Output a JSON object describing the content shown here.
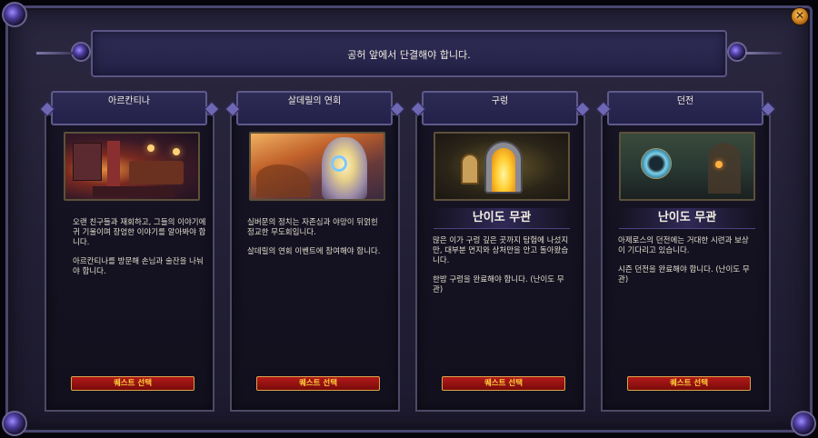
{
  "window": {
    "close_symbol": "✕"
  },
  "banner": {
    "text": "공허 앞에서 단결해야 합니다."
  },
  "cards": [
    {
      "title": "아르칸티나",
      "difficulty": "",
      "description": [
        "오랜 친구들과 재회하고, 그들의 이야기에 귀 기울이며 장엄한 이야기를 알아봐야 합니다.",
        "아르칸티나를 방문해 손님과 술잔을 나눠야 합니다."
      ],
      "button_label": "퀘스트 선택",
      "image_icon": "tavern-scene-image"
    },
    {
      "title": "살데릴의 연회",
      "difficulty": "",
      "description": [
        "실버문의 정치는 자존심과 야망이 뒤얽힌 정교한 무도회입니다.",
        "살데릴의 연회 이벤트에 참여해야 합니다."
      ],
      "button_label": "퀘스트 선택",
      "image_icon": "glowing-tree-image"
    },
    {
      "title": "구렁",
      "difficulty": "난이도 무관",
      "description": [
        "많은 이가 구렁 깊은 곳까지 탐험에 나섰지만, 대부분 먼지와 상처만을 안고 돌아왔습니다.",
        "한밤 구렁을 완료해야 합니다. (난이도 무관)"
      ],
      "button_label": "퀘스트 선택",
      "image_icon": "stone-portal-icon"
    },
    {
      "title": "던전",
      "difficulty": "난이도 무관",
      "description": [
        "아제로스의 던전에는 거대한 시련과 보상이 기다리고 있습니다.",
        "시즌 던전을 완료해야 합니다. (난이도 무관)"
      ],
      "button_label": "퀘스트 선택",
      "image_icon": "dungeon-portal-icon"
    }
  ],
  "colors": {
    "frame": "#2a2740",
    "button": "#9a1010",
    "button_text": "#ffd23a",
    "card_border": "#4c4a66"
  }
}
